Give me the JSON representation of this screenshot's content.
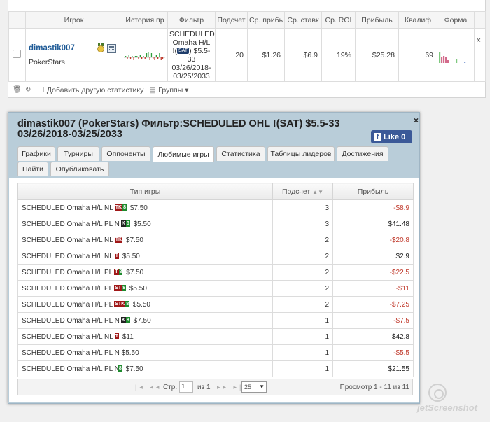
{
  "top_table": {
    "headers": [
      "Игрок",
      "История пр",
      "Фильтр",
      "Подсчет",
      "Ср. прибь",
      "Ср. ставк",
      "Ср. ROI",
      "Прибыль",
      "Квалиф",
      "Форма"
    ],
    "row": {
      "player_name": "dimastik007",
      "room": "PokerStars",
      "filter_line1": "SCHEDULED",
      "filter_line2": "Omaha H/L",
      "filter_badge": "SAT",
      "filter_line3": "$5.5-",
      "filter_line4": "33",
      "filter_line5": "03/26/2018-",
      "filter_line6": "03/25/2033",
      "count": "20",
      "avg_profit": "$1.26",
      "avg_stake": "$6.9",
      "avg_roi": "19%",
      "profit": "$25.28",
      "qualif": "69",
      "close_glyph": "×"
    },
    "footer": {
      "add_stats": "Добавить другую статистику",
      "groups": "Группы"
    }
  },
  "dialog": {
    "title": "dimastik007 (PokerStars) Фильтр:SCHEDULED OHL !(SAT) $5.5-33 03/26/2018-03/25/2033",
    "close": "×",
    "like_label": "Like 0",
    "tabs": [
      "Графики",
      "Турниры",
      "Оппоненты",
      "Любимые игры",
      "Статистика",
      "Таблицы лидеров",
      "Достижения",
      "Найти",
      "Опубликовать"
    ],
    "active_tab": "Любимые игры",
    "grid": {
      "headers": [
        "Тип игры",
        "Подсчет",
        "Прибыль"
      ],
      "rows": [
        {
          "prefix": "SCHEDULED Omaha H/L NL",
          "badge": "TK",
          "badge_color": "#a01818",
          "badge2": "8",
          "stake": "$7.50",
          "count": "3",
          "profit": "-$8.9",
          "neg": true
        },
        {
          "prefix": "SCHEDULED Omaha H/L PL N",
          "badge": "K",
          "badge_color": "#222222",
          "badge2": "8",
          "stake": "$5.50",
          "count": "3",
          "profit": "$41.48",
          "neg": false
        },
        {
          "prefix": "SCHEDULED Omaha H/L NL",
          "badge": "TK",
          "badge_color": "#a01818",
          "badge2": "",
          "stake": "$7.50",
          "count": "2",
          "profit": "-$20.8",
          "neg": true
        },
        {
          "prefix": "SCHEDULED Omaha H/L NL",
          "badge": "T",
          "badge_color": "#a01818",
          "badge2": "",
          "stake": "$5.50",
          "count": "2",
          "profit": "$2.9",
          "neg": false
        },
        {
          "prefix": "SCHEDULED Omaha H/L PL",
          "badge": "T",
          "badge_color": "#a01818",
          "badge2": "8",
          "stake": "$7.50",
          "count": "2",
          "profit": "-$22.5",
          "neg": true
        },
        {
          "prefix": "SCHEDULED Omaha H/L PL",
          "badge": "ST",
          "badge_color": "#a01818",
          "badge2": "8",
          "stake": "$5.50",
          "count": "2",
          "profit": "-$11",
          "neg": true
        },
        {
          "prefix": "SCHEDULED Omaha H/L PL",
          "badge": "STK",
          "badge_color": "#a01818",
          "badge2": "8",
          "stake": "$5.50",
          "count": "2",
          "profit": "-$7.25",
          "neg": true
        },
        {
          "prefix": "SCHEDULED Omaha H/L PL N",
          "badge": "K",
          "badge_color": "#222222",
          "badge2": "8",
          "stake": "$7.50",
          "count": "1",
          "profit": "-$7.5",
          "neg": true
        },
        {
          "prefix": "SCHEDULED Omaha H/L NL",
          "badge": "T",
          "badge_color": "#a01818",
          "badge2": "",
          "stake": "$11",
          "count": "1",
          "profit": "$42.8",
          "neg": false
        },
        {
          "prefix": "SCHEDULED Omaha H/L PL N",
          "badge": "",
          "badge_color": "",
          "badge2": "",
          "stake": "$5.50",
          "count": "1",
          "profit": "-$5.5",
          "neg": true
        },
        {
          "prefix": "SCHEDULED Omaha H/L PL N",
          "badge": "",
          "badge_color": "",
          "badge2": "8",
          "stake": "$7.50",
          "count": "1",
          "profit": "$21.55",
          "neg": false
        }
      ]
    },
    "pager": {
      "page_label": "Стр.",
      "page_value": "1",
      "of_label": "из 1",
      "page_size": "25",
      "view_label": "Просмотр 1 - 11 из 11"
    }
  },
  "watermark": "jetScreenshot"
}
